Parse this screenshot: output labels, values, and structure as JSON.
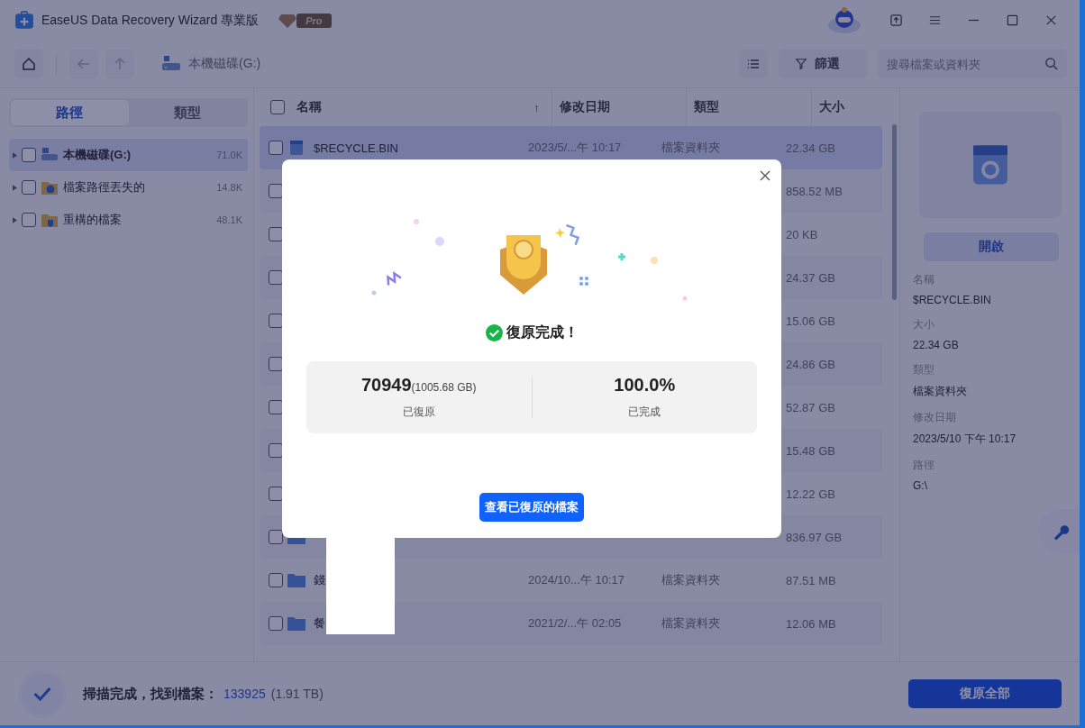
{
  "window": {
    "title": "EaseUS Data Recovery Wizard 專業版",
    "badge": "Pro"
  },
  "toolbar": {
    "location": "本機磁碟(G:)",
    "filter_button": "篩選",
    "search": {
      "placeholder": "搜尋檔案或資料夾"
    }
  },
  "sidebar": {
    "tabs": [
      {
        "label": "路徑",
        "selected": true
      },
      {
        "label": "類型",
        "selected": false
      }
    ],
    "items": [
      {
        "label": "本機磁碟(G:)",
        "count": "71.0K",
        "selected": true,
        "kind": "drive"
      },
      {
        "label": "檔案路徑丟失的",
        "count": "14.8K",
        "selected": false,
        "kind": "lost"
      },
      {
        "label": "重構的檔案",
        "count": "48.1K",
        "selected": false,
        "kind": "rebuilt"
      }
    ]
  },
  "table": {
    "select_all": {
      "checked": false
    },
    "columns": [
      "名稱",
      "修改日期",
      "類型",
      "大小"
    ],
    "sort_indicator": "↑",
    "rows": [
      {
        "kind": "recycle",
        "name": "$RECYCLE.BIN",
        "modified": "2023/5/...午 10:17",
        "type": "檔案資料夾",
        "size": "22.34 GB",
        "selected": true
      },
      {
        "size": "858.52 MB",
        "selected": false
      },
      {
        "size": "20 KB",
        "selected": false
      },
      {
        "size": "24.37 GB",
        "selected": false
      },
      {
        "size": "15.06 GB",
        "selected": false
      },
      {
        "size": "24.86 GB",
        "selected": false
      },
      {
        "size": "52.87 GB",
        "selected": false
      },
      {
        "size": "15.48 GB",
        "selected": false
      },
      {
        "size": "12.22 GB",
        "selected": false
      },
      {
        "kind": "folder",
        "size": "836.97 GB",
        "selected": false
      },
      {
        "kind": "folder",
        "name": "錢",
        "modified": "2024/10...午 10:17",
        "type": "檔案資料夾",
        "size": "87.51 MB",
        "selected": false
      },
      {
        "kind": "folder",
        "name": "餐",
        "modified": "2021/2/...午 02:05",
        "type": "檔案資料夾",
        "size": "12.06 MB",
        "selected": false
      }
    ]
  },
  "details": {
    "open_button": "開啟",
    "fields": [
      {
        "label": "名稱",
        "value": "$RECYCLE.BIN"
      },
      {
        "label": "大小",
        "value": "22.34 GB"
      },
      {
        "label": "類型",
        "value": "檔案資料夾"
      },
      {
        "label": "修改日期",
        "value": "2023/5/10 下午 10:17"
      },
      {
        "label": "路徑",
        "value": "G:\\"
      }
    ]
  },
  "status_bar": {
    "message": "掃描完成，找到檔案：",
    "count": "133925",
    "size": "(1.91 TB)",
    "recover_button": "復原全部"
  },
  "dialog": {
    "title": "復原完成！",
    "stats": [
      {
        "value": "70949",
        "detail": "(1005.68 GB)",
        "label": "已復原"
      },
      {
        "value": "100.0%",
        "label": "已完成"
      }
    ],
    "button": "查看已復原的檔案"
  }
}
